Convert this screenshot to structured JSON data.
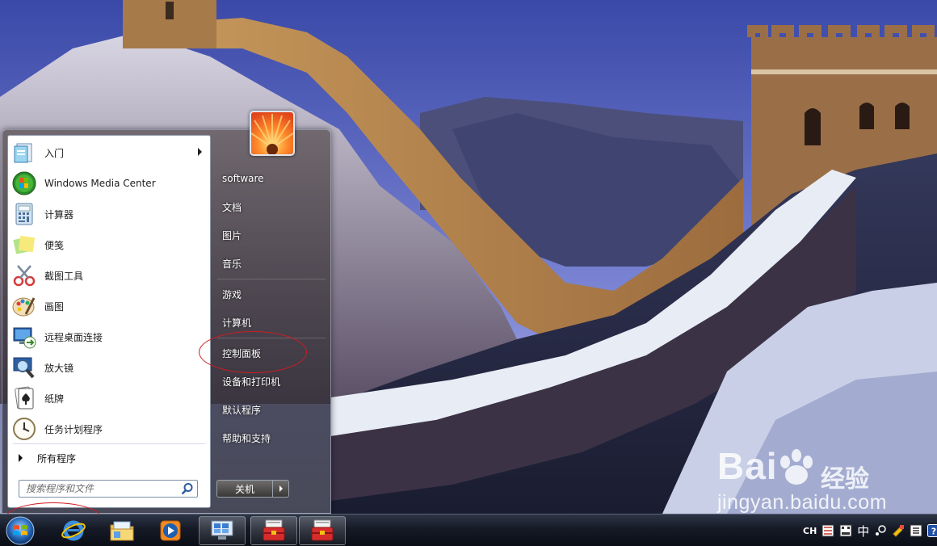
{
  "start_menu": {
    "programs": [
      {
        "label": "入门",
        "icon": "getting-started-icon",
        "has_submenu": true
      },
      {
        "label": "Windows Media Center",
        "icon": "windows-media-center-icon",
        "has_submenu": false
      },
      {
        "label": "计算器",
        "icon": "calculator-icon",
        "has_submenu": false
      },
      {
        "label": "便笺",
        "icon": "sticky-notes-icon",
        "has_submenu": false
      },
      {
        "label": "截图工具",
        "icon": "snipping-tool-icon",
        "has_submenu": false
      },
      {
        "label": "画图",
        "icon": "paint-icon",
        "has_submenu": false
      },
      {
        "label": "远程桌面连接",
        "icon": "remote-desktop-icon",
        "has_submenu": false
      },
      {
        "label": "放大镜",
        "icon": "magnifier-icon",
        "has_submenu": false
      },
      {
        "label": "纸牌",
        "icon": "solitaire-icon",
        "has_submenu": false
      },
      {
        "label": "任务计划程序",
        "icon": "task-scheduler-icon",
        "has_submenu": false
      }
    ],
    "all_programs_label": "所有程序",
    "search_placeholder": "搜索程序和文件",
    "right_items": [
      {
        "label": "software",
        "name": "right-item-software"
      },
      {
        "label": "文档",
        "name": "right-item-documents"
      },
      {
        "label": "图片",
        "name": "right-item-pictures"
      },
      {
        "label": "音乐",
        "name": "right-item-music"
      },
      {
        "label": "游戏",
        "name": "right-item-games"
      },
      {
        "label": "计算机",
        "name": "right-item-computer"
      },
      {
        "label": "控制面板",
        "name": "right-item-control-panel"
      },
      {
        "label": "设备和打印机",
        "name": "right-item-devices-printers"
      },
      {
        "label": "默认程序",
        "name": "right-item-default-programs"
      },
      {
        "label": "帮助和支持",
        "name": "right-item-help-support"
      }
    ],
    "shutdown_label": "关机"
  },
  "taskbar": {
    "pinned": [
      {
        "icon": "internet-explorer-icon"
      },
      {
        "icon": "windows-explorer-icon"
      },
      {
        "icon": "media-player-icon"
      },
      {
        "icon": "remote-desktop-taskbar-icon"
      },
      {
        "icon": "toolbox-app-icon"
      },
      {
        "icon": "toolbox-app-icon"
      }
    ],
    "tray": {
      "lang": "CH",
      "ime": "中"
    }
  },
  "watermark": {
    "brand": "Bai",
    "brand_suffix": "经验",
    "url": "jingyan.baidu.com"
  },
  "colors": {
    "annotation": "#d11b22",
    "taskbar": "#151a26",
    "menu_pane": "#ffffff"
  }
}
